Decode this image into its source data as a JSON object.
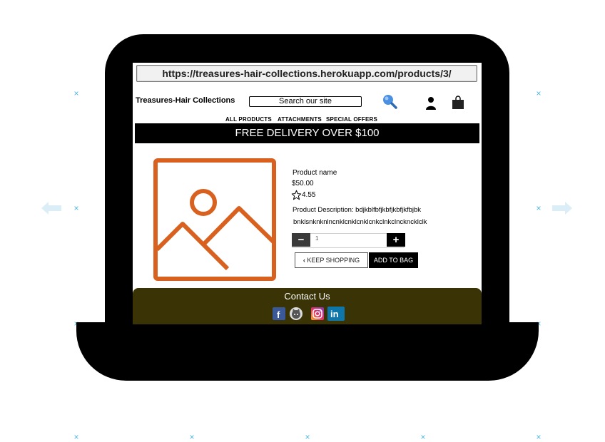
{
  "browser": {
    "url": "https://treasures-hair-collections.herokuapp.com/products/3/"
  },
  "header": {
    "brand": "Treasures-Hair Collections",
    "search_placeholder": "Search our site"
  },
  "nav": {
    "items": [
      "ALL PRODUCTS",
      "ATTACHMENTS",
      "SPECIAL OFFERS"
    ]
  },
  "banner": "FREE DELIVERY OVER $100",
  "product": {
    "name": "Product name",
    "price": "$50.00",
    "rating": "4.55",
    "description_line1": "Product Description: bdjkblfbfjkbfjkbfjkfbjbk",
    "description_line2": "bnklsnknknlncnklcnklcnklcnkclnkclnckncklclk",
    "quantity": "1"
  },
  "actions": {
    "keep_shopping": "KEEP SHOPPING",
    "add_to_bag": "ADD TO BAG"
  },
  "footer": {
    "title": "Contact Us",
    "social": [
      "facebook-icon",
      "github-icon",
      "instagram-icon",
      "linkedin-icon"
    ]
  },
  "colors": {
    "image_placeholder": "#d9611f",
    "footer_bg": "#393306",
    "search_icon": "#4a90e2",
    "wireframe_marker": "#4fb6e3"
  }
}
